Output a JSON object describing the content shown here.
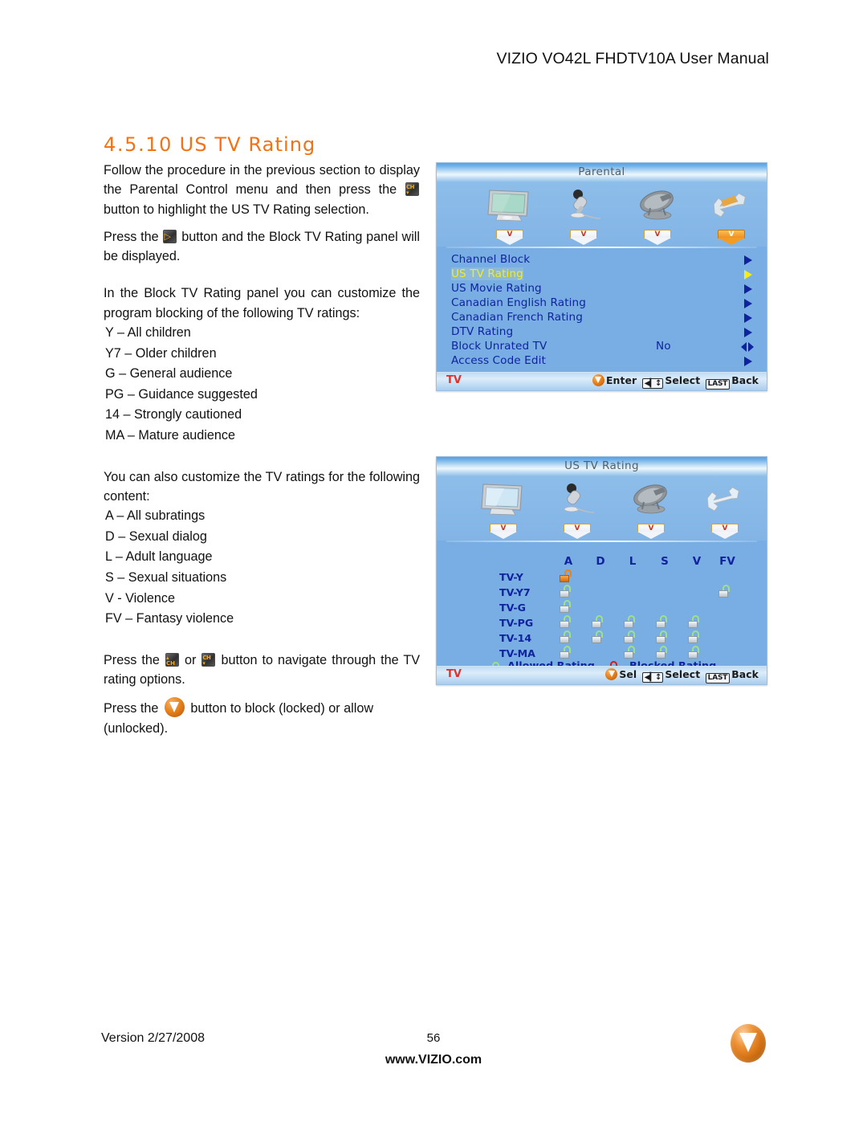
{
  "header": {
    "title": "VIZIO VO42L FHDTV10A User Manual"
  },
  "section": {
    "number": "4.5.10",
    "title": "US TV Rating"
  },
  "body": {
    "p1_a": "Follow the procedure in the previous section to display the Parental Control menu and then press the",
    "p1_b": "button to highlight the US TV Rating selection.",
    "p2_a": "Press the",
    "p2_b": "button and the Block TV Rating panel will be displayed.",
    "p3": "In the Block TV Rating panel you can customize the program blocking of the following TV ratings:",
    "ratings": [
      "Y – All children",
      "Y7 – Older children",
      "G – General audience",
      "PG – Guidance suggested",
      "14 – Strongly cautioned",
      "MA – Mature audience"
    ],
    "p4": "You can also customize the TV ratings for the following content:",
    "content_codes": [
      "A – All subratings",
      "D – Sexual dialog",
      "L – Adult language",
      "S – Sexual situations",
      "V - Violence",
      "FV – Fantasy violence"
    ],
    "p5_a": "Press the",
    "p5_or": "or",
    "p5_b": "button to navigate through the TV rating options.",
    "p6_a": "Press the",
    "p6_b": "button to block (locked) or allow (unlocked)."
  },
  "osd_parental": {
    "title": "Parental",
    "tabs": [
      {
        "icon": "tv-monitor-icon",
        "letter": "V",
        "active": false
      },
      {
        "icon": "microphone-icon",
        "letter": "V",
        "active": false
      },
      {
        "icon": "satellite-dish-icon",
        "letter": "V",
        "active": false
      },
      {
        "icon": "wrench-icon",
        "letter": "V",
        "active": true
      }
    ],
    "rows": [
      {
        "label": "Channel Block",
        "value": "",
        "arrow": "right",
        "selected": false
      },
      {
        "label": "US TV Rating",
        "value": "",
        "arrow": "right",
        "selected": true
      },
      {
        "label": "US Movie Rating",
        "value": "",
        "arrow": "right",
        "selected": false
      },
      {
        "label": "Canadian English Rating",
        "value": "",
        "arrow": "right",
        "selected": false
      },
      {
        "label": "Canadian French Rating",
        "value": "",
        "arrow": "right",
        "selected": false
      },
      {
        "label": "DTV Rating",
        "value": "",
        "arrow": "right",
        "selected": false
      },
      {
        "label": "Block Unrated TV",
        "value": "No",
        "arrow": "leftright",
        "selected": false
      },
      {
        "label": "Access Code Edit",
        "value": "",
        "arrow": "right",
        "selected": false
      }
    ],
    "status": {
      "source": "TV",
      "action_label": "Enter",
      "nav_key": "◀▎↕",
      "select_label": "Select",
      "last_key": "LAST",
      "back_label": "Back"
    }
  },
  "osd_tvrating": {
    "title": "US  TV Rating",
    "tabs": [
      {
        "icon": "tv-monitor-icon",
        "letter": "V",
        "active": false
      },
      {
        "icon": "microphone-icon",
        "letter": "V",
        "active": false
      },
      {
        "icon": "satellite-dish-icon",
        "letter": "V",
        "active": false
      },
      {
        "icon": "wrench-icon",
        "letter": "V",
        "active": false
      }
    ],
    "grid": {
      "columns": [
        "A",
        "D",
        "L",
        "S",
        "V",
        "FV"
      ],
      "rows": [
        {
          "label": "TV-Y",
          "cells": [
            "open",
            "",
            "",
            "",
            "",
            ""
          ]
        },
        {
          "label": "TV-Y7",
          "cells": [
            "allowed",
            "",
            "",
            "",
            "",
            "allowed"
          ]
        },
        {
          "label": "TV-G",
          "cells": [
            "allowed",
            "",
            "",
            "",
            "",
            ""
          ]
        },
        {
          "label": "TV-PG",
          "cells": [
            "allowed",
            "allowed",
            "allowed",
            "allowed",
            "allowed",
            ""
          ]
        },
        {
          "label": "TV-14",
          "cells": [
            "allowed",
            "allowed",
            "allowed",
            "allowed",
            "allowed",
            ""
          ]
        },
        {
          "label": "TV-MA",
          "cells": [
            "allowed",
            "",
            "allowed",
            "allowed",
            "allowed",
            ""
          ]
        }
      ]
    },
    "legend": {
      "allowed": "Allowed Rating",
      "blocked": "Blocked Rating"
    },
    "status": {
      "source": "TV",
      "action_label": "Sel",
      "nav_key": "◀▎↕",
      "select_label": "Select",
      "last_key": "LAST",
      "back_label": "Back"
    }
  },
  "footer": {
    "version": "Version 2/27/2008",
    "page": "56",
    "site": "www.VIZIO.com"
  }
}
